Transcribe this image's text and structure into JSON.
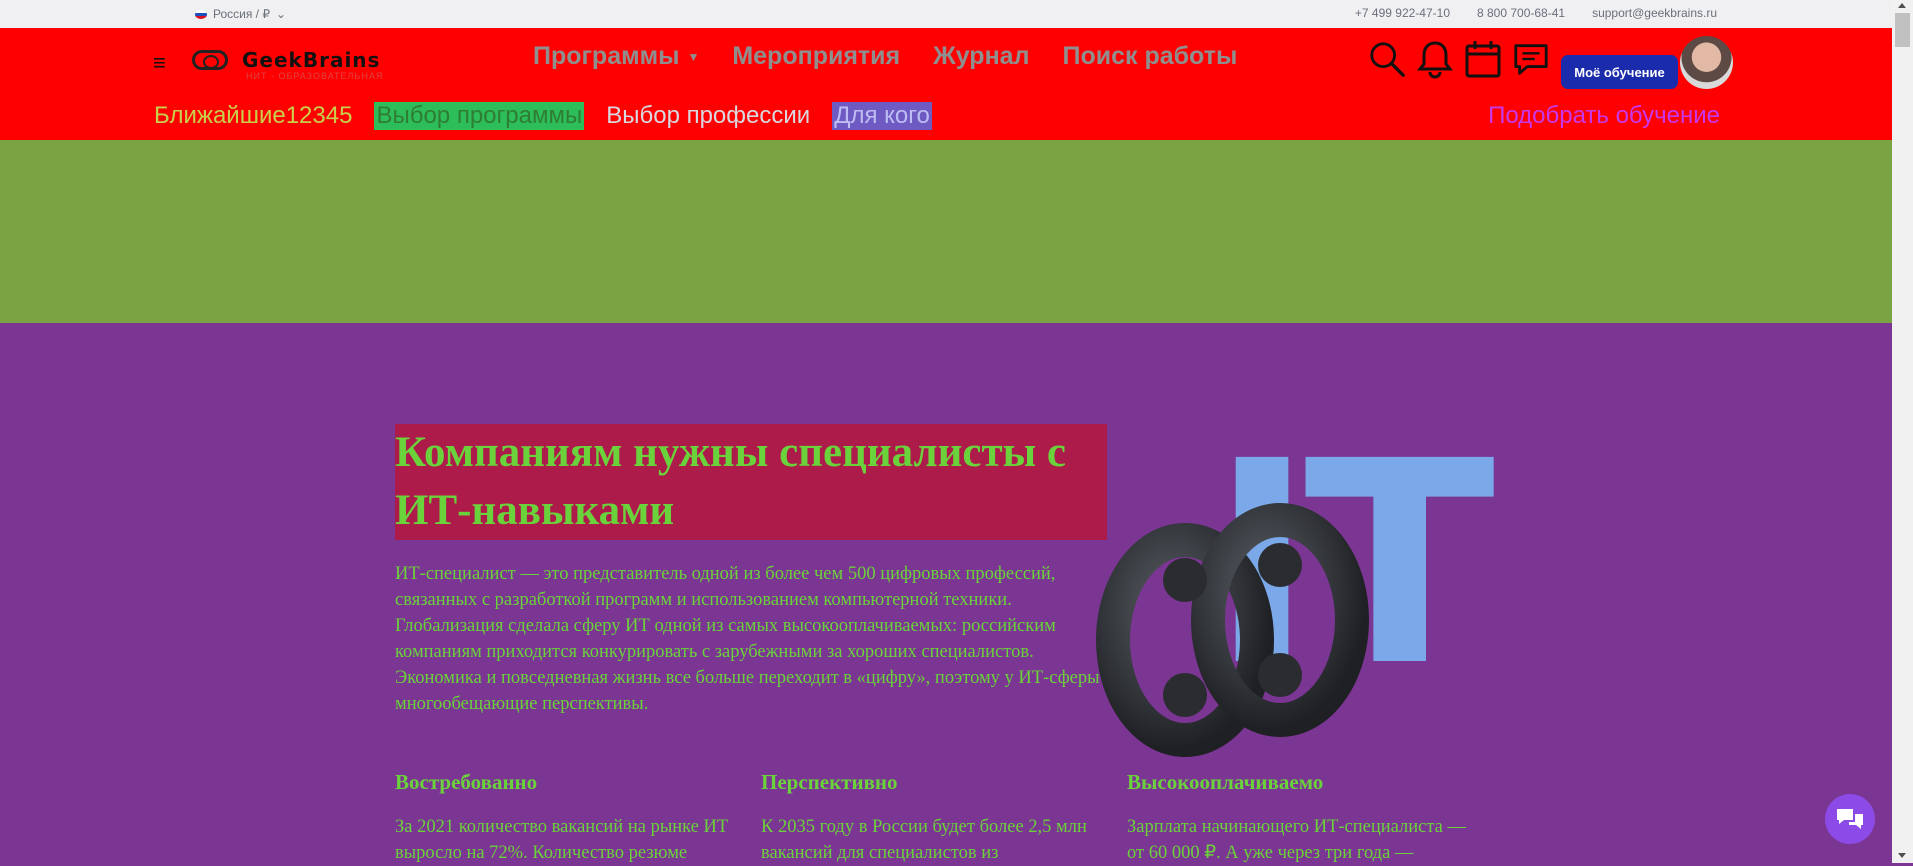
{
  "topbar": {
    "region": "Россия / ₽",
    "contacts": [
      "+7 499 922-47-10",
      "8 800 700-68-41",
      "support@geekbrains.ru"
    ]
  },
  "header": {
    "logo_text": "GeekBrains",
    "logo_subtitle": "НИТ - ОБРАЗОВАТЕЛЬНАЯ",
    "nav": [
      "Программы",
      "Мероприятия",
      "Журнал",
      "Поиск работы"
    ],
    "my_learning": "Моё обучение",
    "icons": [
      "search-icon",
      "bell-icon",
      "calendar-icon",
      "chat-icon"
    ]
  },
  "subnav": {
    "nearest": "Ближайшие12345",
    "program": "Выбор программы",
    "profession": "Выбор профессии",
    "for_whom": "Для кого",
    "pick": "Подобрать обучение"
  },
  "hero": {
    "title": "Компаниям нужны специалисты с ИТ-навыками",
    "text": "ИТ-специалист — это представитель одной из более чем 500 цифровых профессий, связанных с разработкой программ и использованием компьютерной техники. Глобализация сделала сферу ИТ одной из самых высокооплачиваемых: российским компаниям приходится конкурировать с зарубежными за хороших специалистов. Экономика и повседневная жизнь все больше переходит в «цифру», поэтому у ИТ-сферы многообещающие перспективы.",
    "art_letters": "IT"
  },
  "features": [
    {
      "title": "Востребованно",
      "text": "За 2021 количество вакансий на рынке ИТ выросло на 72%. Количество резюме"
    },
    {
      "title": "Перспективно",
      "text": "К 2035 году в России будет более 2,5 млн вакансий для специалистов из"
    },
    {
      "title": "Высокооплачиваемо",
      "text": "Зарплата начинающего ИТ-специалиста — от 60 000 ₽. А уже через три года —"
    }
  ],
  "colors": {
    "header_bg": "#ff0000",
    "green_band": "#7aa343",
    "main_bg": "#7b3593",
    "accent_green": "#6ad23a",
    "title_bg": "#ad1b4b",
    "button_blue": "#1a2bab"
  }
}
